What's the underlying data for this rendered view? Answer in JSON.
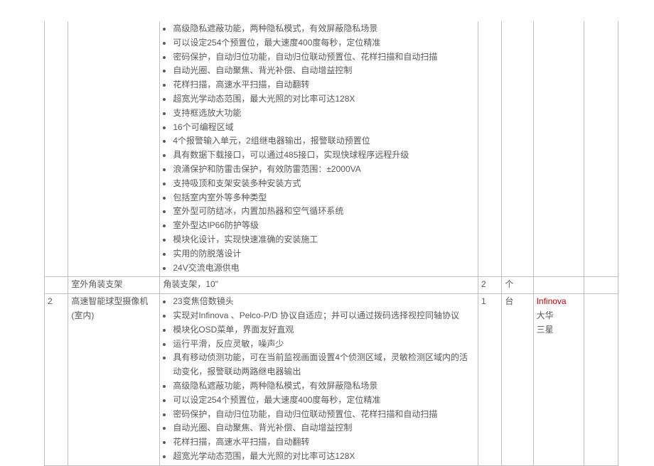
{
  "rows": [
    {
      "no": "",
      "name": "",
      "desc_items": [
        "高级隐私遮蔽功能，两种隐私模式，有效屏蔽隐私场景",
        "可以设定254个预置位，最大速度400度每秒，定位精准",
        "密码保护，自动归位功能，自动归位联动预置位、花样扫描和自动扫描",
        "自动光圈、自动聚焦、背光补偿、自动增益控制",
        "花样扫描，高速水平扫描，自动翻转",
        "超宽光学动态范围，最大光照的对比率可达128X",
        "支持框选放大功能",
        "16个可编程区域",
        "4个报警输入单元，2组继电器输出，报警联动预置位",
        "具有数据下载接口，可以通过485接口，实现快球程序远程升级",
        "浪涌保护和防雷击保护，有效防雷范围：±2000VA",
        "支持吸顶和支架安装多种安装方式",
        "包括室内室外等多种类型",
        "室外型可防结冰，内置加热器和空气循环系统",
        "室外型达IP66防护等级",
        "模块化设计，实现快速准确的安装施工",
        "实用的防脱落设计",
        "24V交流电源供电"
      ],
      "qty": "",
      "unit": "",
      "brands": [],
      "blank": ""
    },
    {
      "no": "",
      "name": "室外角装支架",
      "desc_text": "角装支架，10\"",
      "qty": "2",
      "unit": "个",
      "brands": [],
      "blank": ""
    },
    {
      "no": "2",
      "name": "高速智能球型摄像机(室内)",
      "desc_items": [
        "23变焦倍数镜头",
        "实现对Infinova 、Pelco-P/D 协议自适应；并可以通过拨码选择视控同轴协议",
        "模块化OSD菜单，界面友好直观",
        "运行平滑，反应灵敏，噪声少",
        "具有移动侦测功能，可在当前监视画面设置4个侦测区域，灵敏检测区域内的活动变化，报警联动两路继电器输出",
        "高级隐私遮蔽功能，两种隐私模式，有效屏蔽隐私场景",
        "可以设定254个预置位，最大速度400度每秒，定位精准",
        "密码保护，自动归位功能，自动归位联动预置位、花样扫描和自动扫描",
        "自动光圈、自动聚焦、背光补偿、自动增益控制",
        "花样扫描，高速水平扫描，自动翻转",
        "超宽光学动态范围，最大光照的对比率可达128X"
      ],
      "qty": "1",
      "unit": "台",
      "brands": [
        "Infinova",
        "大华",
        "三星"
      ],
      "brand_highlight_index": 0,
      "blank": ""
    }
  ]
}
